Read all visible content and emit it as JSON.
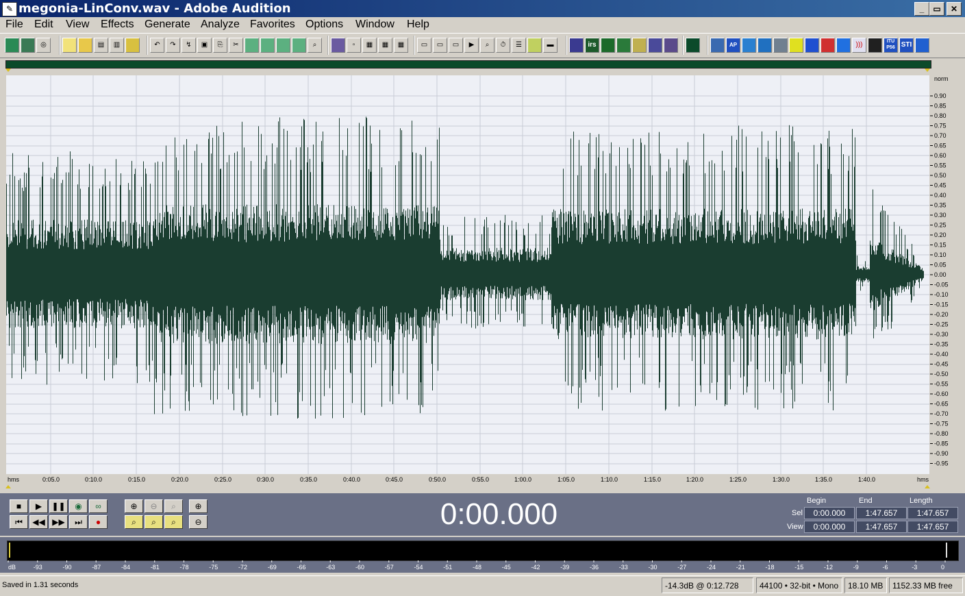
{
  "window": {
    "title": "megonia-LinConv.wav - Adobe Audition",
    "app_icon": "audition-icon",
    "controls": [
      "_",
      "▭",
      "✕"
    ]
  },
  "menu": [
    "File",
    "Edit",
    "View",
    "Effects",
    "Generate",
    "Analyze",
    "Favorites",
    "Options",
    "Window",
    "Help"
  ],
  "toolbar": {
    "plugin_labels": [
      "irs",
      "ITU P56",
      "STI",
      "AP 42",
      "MLS"
    ]
  },
  "colors": {
    "waveform": "#1a3d30",
    "wave_bg": "#eef0f6",
    "grid": "#c8ccd6",
    "transport_bg": "#6a7086"
  },
  "waveform": {
    "ruler_right_top": "norm",
    "ruler_right": [
      "0.90",
      "0.85",
      "0.80",
      "0.75",
      "0.70",
      "0.65",
      "0.60",
      "0.55",
      "0.50",
      "0.45",
      "0.40",
      "0.35",
      "0.30",
      "0.25",
      "0.20",
      "0.15",
      "0.10",
      "0.05",
      "0.00",
      "-0.05",
      "-0.10",
      "-0.15",
      "-0.20",
      "-0.25",
      "-0.30",
      "-0.35",
      "-0.40",
      "-0.45",
      "-0.50",
      "-0.55",
      "-0.60",
      "-0.65",
      "-0.70",
      "-0.75",
      "-0.80",
      "-0.85",
      "-0.90",
      "-0.95"
    ],
    "time_labels": [
      "hms",
      "0:05.0",
      "0:10.0",
      "0:15.0",
      "0:20.0",
      "0:25.0",
      "0:30.0",
      "0:35.0",
      "0:40.0",
      "0:45.0",
      "0:50.0",
      "0:55.0",
      "1:00.0",
      "1:05.0",
      "1:10.0",
      "1:15.0",
      "1:20.0",
      "1:25.0",
      "1:30.0",
      "1:35.0",
      "1:40.0",
      "hms"
    ]
  },
  "transport": {
    "time": "0:00.000",
    "headers": {
      "begin": "Begin",
      "end": "End",
      "length": "Length"
    },
    "rows": {
      "sel": {
        "label": "Sel",
        "begin": "0:00.000",
        "end": "1:47.657",
        "length": "1:47.657"
      },
      "view": {
        "label": "View",
        "begin": "0:00.000",
        "end": "1:47.657",
        "length": "1:47.657"
      }
    }
  },
  "meter": {
    "db_labels": [
      "dB",
      "-93",
      "-90",
      "-87",
      "-84",
      "-81",
      "-78",
      "-75",
      "-72",
      "-69",
      "-66",
      "-63",
      "-60",
      "-57",
      "-54",
      "-51",
      "-48",
      "-45",
      "-42",
      "-39",
      "-36",
      "-33",
      "-30",
      "-27",
      "-24",
      "-21",
      "-18",
      "-15",
      "-12",
      "-9",
      "-6",
      "-3",
      "0"
    ]
  },
  "status": {
    "message": "Saved in 1.31 seconds",
    "level": "-14.3dB @  0:12.728",
    "format": "44100 • 32-bit • Mono",
    "file_size": "18.10 MB",
    "free_space": "1152.33 MB free"
  }
}
